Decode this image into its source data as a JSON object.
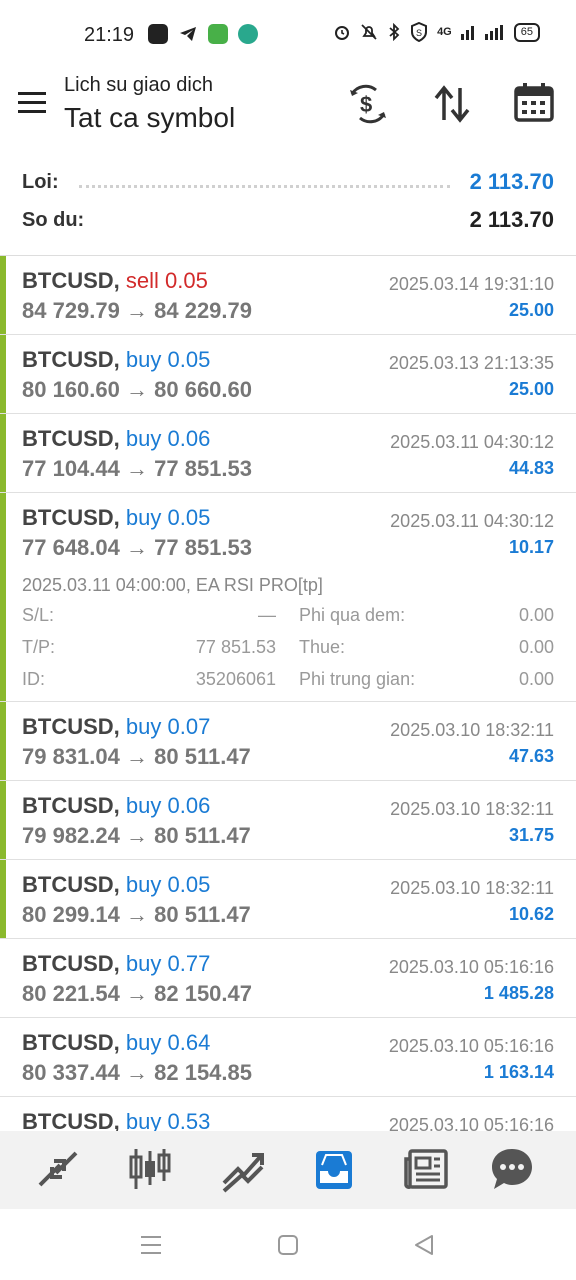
{
  "status_bar": {
    "time": "21:19",
    "network": "4G",
    "battery": "65",
    "app_icons": [
      "zalo-icon",
      "telegram-icon",
      "android-icon",
      "messenger-icon"
    ],
    "system_icons": [
      "alarm-icon",
      "bell-off-icon",
      "bluetooth-icon",
      "shield-icon",
      "signal-icon"
    ]
  },
  "header": {
    "subtitle": "Lich su giao dich",
    "title": "Tat ca symbol",
    "icons": [
      "currency-exchange-icon",
      "sort-icon",
      "calendar-icon"
    ]
  },
  "summary": {
    "profit_label": "Loi:",
    "profit_value": "2 113.70",
    "balance_label": "So du:",
    "balance_value": "2 113.70"
  },
  "colors": {
    "buy": "#1a7bd4",
    "sell": "#d22a2a",
    "profit": "#1a7bd4",
    "bar": "#8ab92d",
    "active_nav": "#1a7bd4"
  },
  "trades": [
    {
      "symbol": "BTCUSD,",
      "side": "sell",
      "volume": "0.05",
      "open_price": "84 729.79",
      "close_price": "84 229.79",
      "datetime": "2025.03.14 19:31:10",
      "profit": "25.00",
      "bar": true
    },
    {
      "symbol": "BTCUSD,",
      "side": "buy",
      "volume": "0.05",
      "open_price": "80 160.60",
      "close_price": "80 660.60",
      "datetime": "2025.03.13 21:13:35",
      "profit": "25.00",
      "bar": true
    },
    {
      "symbol": "BTCUSD,",
      "side": "buy",
      "volume": "0.06",
      "open_price": "77 104.44",
      "close_price": "77 851.53",
      "datetime": "2025.03.11 04:30:12",
      "profit": "44.83",
      "bar": true
    },
    {
      "symbol": "BTCUSD,",
      "side": "buy",
      "volume": "0.05",
      "open_price": "77 648.04",
      "close_price": "77 851.53",
      "datetime": "2025.03.11 04:30:12",
      "profit": "10.17",
      "bar": true,
      "expanded": {
        "open_info": "2025.03.11 04:00:00, EA RSI PRO[tp]",
        "sl_label": "S/L:",
        "sl_value": "—",
        "swap_label": "Phi qua dem:",
        "swap_value": "0.00",
        "tp_label": "T/P:",
        "tp_value": "77 851.53",
        "tax_label": "Thue:",
        "tax_value": "0.00",
        "id_label": "ID:",
        "id_value": "35206061",
        "fee_label": "Phi trung gian:",
        "fee_value": "0.00"
      }
    },
    {
      "symbol": "BTCUSD,",
      "side": "buy",
      "volume": "0.07",
      "open_price": "79 831.04",
      "close_price": "80 511.47",
      "datetime": "2025.03.10 18:32:11",
      "profit": "47.63",
      "bar": true
    },
    {
      "symbol": "BTCUSD,",
      "side": "buy",
      "volume": "0.06",
      "open_price": "79 982.24",
      "close_price": "80 511.47",
      "datetime": "2025.03.10 18:32:11",
      "profit": "31.75",
      "bar": true
    },
    {
      "symbol": "BTCUSD,",
      "side": "buy",
      "volume": "0.05",
      "open_price": "80 299.14",
      "close_price": "80 511.47",
      "datetime": "2025.03.10 18:32:11",
      "profit": "10.62",
      "bar": true
    },
    {
      "symbol": "BTCUSD,",
      "side": "buy",
      "volume": "0.77",
      "open_price": "80 221.54",
      "close_price": "82 150.47",
      "datetime": "2025.03.10 05:16:16",
      "profit": "1 485.28",
      "bar": false
    },
    {
      "symbol": "BTCUSD,",
      "side": "buy",
      "volume": "0.64",
      "open_price": "80 337.44",
      "close_price": "82 154.85",
      "datetime": "2025.03.10 05:16:16",
      "profit": "1 163.14",
      "bar": false
    },
    {
      "symbol": "BTCUSD,",
      "side": "buy",
      "volume": "0.53",
      "open_price": "",
      "close_price": "",
      "datetime": "2025.03.10 05:16:16",
      "profit": "",
      "bar": false
    }
  ],
  "arrow": "→",
  "bottom_nav": {
    "items": [
      "quotes-icon",
      "chart-icon",
      "trade-icon",
      "history-icon",
      "news-icon",
      "messages-icon"
    ],
    "active_index": 3
  },
  "system_nav": [
    "menu-icon",
    "home-icon",
    "back-icon"
  ]
}
